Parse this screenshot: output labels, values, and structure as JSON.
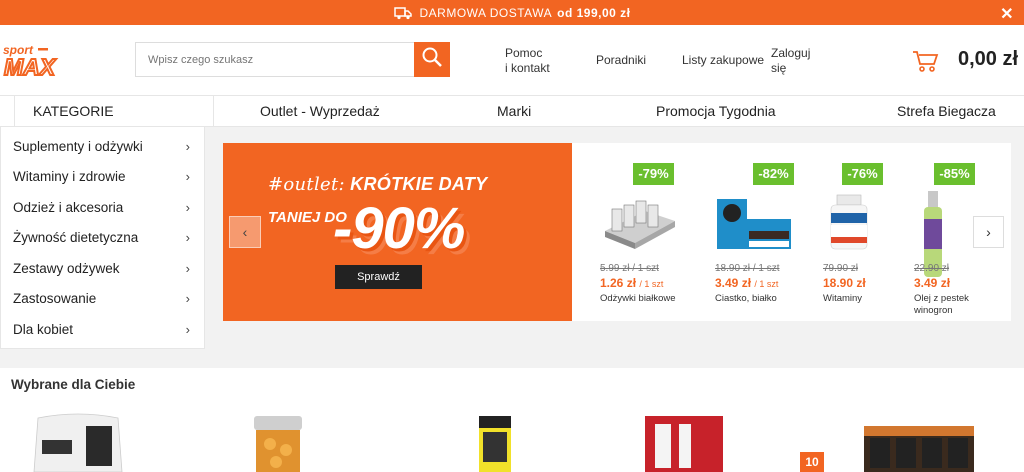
{
  "promo": {
    "text": "DARMOWA DOSTAWA",
    "amount": "od 199,00 zł",
    "close": "✕"
  },
  "header": {
    "logo_top": "sport",
    "logo_bottom": "MAX",
    "search_placeholder": "Wpisz czego szukasz",
    "help_line1": "Pomoc",
    "help_line2": "i kontakt",
    "guides": "Poradniki",
    "shopping_lists": "Listy zakupowe",
    "login_line1": "Zaloguj",
    "login_line2": "się",
    "cart_total": "0,00 zł"
  },
  "nav": {
    "categories": "KATEGORIE",
    "links": [
      "Outlet - Wyprzedaż",
      "Marki",
      "Promocja Tygodnia",
      "Strefa Biegacza"
    ]
  },
  "side_menu": [
    "Suplementy i odżywki",
    "Witaminy i zdrowie",
    "Odzież i akcesoria",
    "Żywność dietetyczna",
    "Zestawy odżywek",
    "Zastosowanie",
    "Dla kobiet"
  ],
  "banner": {
    "hashtag": "#outlet:",
    "headline": "KRÓTKIE DATY",
    "sub": "TANIEJ DO",
    "big": "-90%",
    "button": "Sprawdź"
  },
  "products": [
    {
      "discount": "-79%",
      "old": "5.99 zł",
      "old_unit": "/ 1 szt",
      "new": "1.26 zł",
      "new_unit": "/ 1 szt",
      "name": "Odżywki białkowe"
    },
    {
      "discount": "-82%",
      "old": "18.90 zł",
      "old_unit": "/ 1 szt",
      "new": "3.49 zł",
      "new_unit": "/ 1 szt",
      "name": "Ciastko, białko"
    },
    {
      "discount": "-76%",
      "old": "79.90 zł",
      "old_unit": "",
      "new": "18.90 zł",
      "new_unit": "",
      "name": "Witaminy"
    },
    {
      "discount": "-85%",
      "old": "22.90 zł",
      "old_unit": "",
      "new": "3.49 zł",
      "new_unit": "",
      "name": "Olej z pestek winogron"
    }
  ],
  "recommended": {
    "title": "Wybrane dla Ciebie",
    "badge": "10"
  },
  "colors": {
    "brand": "#f26522",
    "discount": "#6abf2e"
  }
}
